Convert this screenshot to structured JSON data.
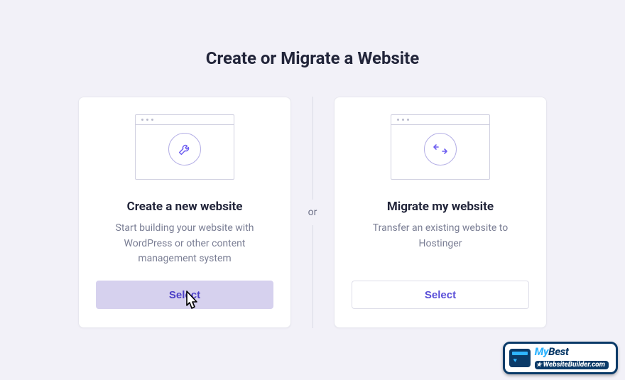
{
  "title": "Create or Migrate a Website",
  "separator": "or",
  "cards": {
    "create": {
      "title": "Create a new website",
      "desc": "Start building your website with WordPress or other content management system",
      "button": "Select"
    },
    "migrate": {
      "title": "Migrate my website",
      "desc": "Transfer an existing website to Hostinger",
      "button": "Select"
    }
  },
  "badge": {
    "line1a": "My",
    "line1b": "Best",
    "line2": "WebsiteBuilder.com"
  }
}
